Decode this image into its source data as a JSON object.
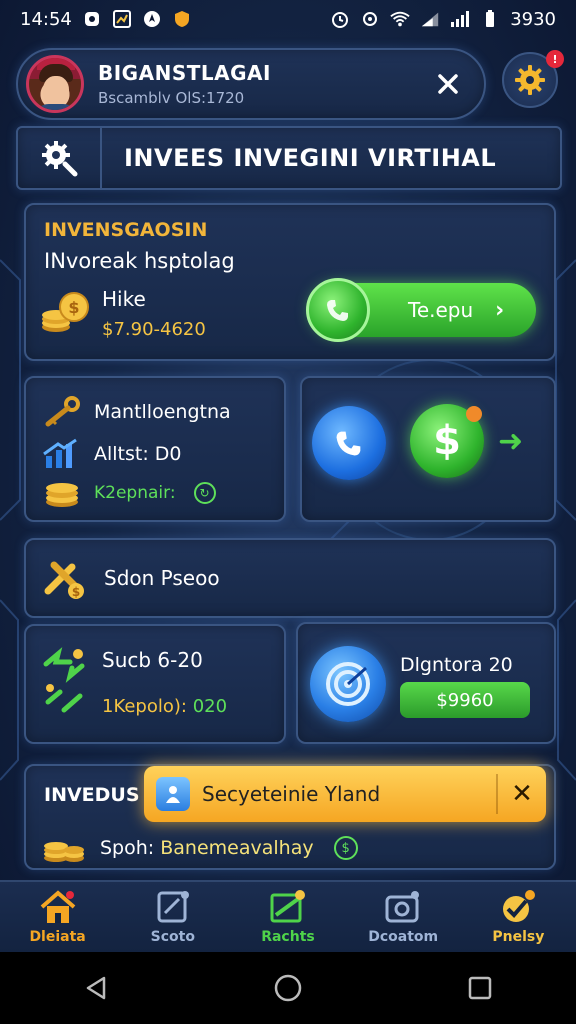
{
  "status_bar": {
    "time": "14:54",
    "battery_text": "3930"
  },
  "profile": {
    "name": "BIGANSTLAGAI",
    "subtitle": "Bscamblv OlS:1720"
  },
  "title_bar": {
    "title": "INVEES INVEGINI VIRTIHAL"
  },
  "settings": {
    "badge": "!"
  },
  "invest_card": {
    "label": "INVENSGAOSIN",
    "subtitle": "INvoreak hsptolag",
    "item_title": "Hike",
    "item_value": "$7.90-4620",
    "button_label": "Te.epu",
    "button_arrow": "›"
  },
  "stats_card": {
    "row1": "Mantlloengtna",
    "row2": "Alltst: D0",
    "row3": "K2epnair:"
  },
  "status_card": {
    "text": "Sdon Pseoo"
  },
  "swap_card": {
    "line1": "Sucb 6-20",
    "line2_a": "1Kepolo): ",
    "line2_b": "020"
  },
  "target_card": {
    "label": "Dlgntora 20",
    "button_label": "$9960"
  },
  "invest_card_2": {
    "label": "INVEDUS",
    "row_label": "Spoh: ",
    "row_value": "Banemeavalhay"
  },
  "toast": {
    "text": "Secyeteinie Yland",
    "close": "✕"
  },
  "bottom_nav": [
    {
      "label": "Dleiata",
      "icon": "home-icon",
      "color": "#f5a623"
    },
    {
      "label": "Scoto",
      "icon": "edit-icon",
      "color": "#9fb4d6"
    },
    {
      "label": "Rachts",
      "icon": "chart-icon",
      "color": "#4fd34a"
    },
    {
      "label": "Dcoatom",
      "icon": "camera-icon",
      "color": "#9fb4d6"
    },
    {
      "label": "Pnelsy",
      "icon": "badge-icon",
      "color": "#f5c443"
    }
  ],
  "colors": {
    "accent_gold": "#f2b53a",
    "accent_green": "#4fd34a",
    "accent_blue": "#2a7fe6",
    "panel_bg": "#1f3257"
  }
}
